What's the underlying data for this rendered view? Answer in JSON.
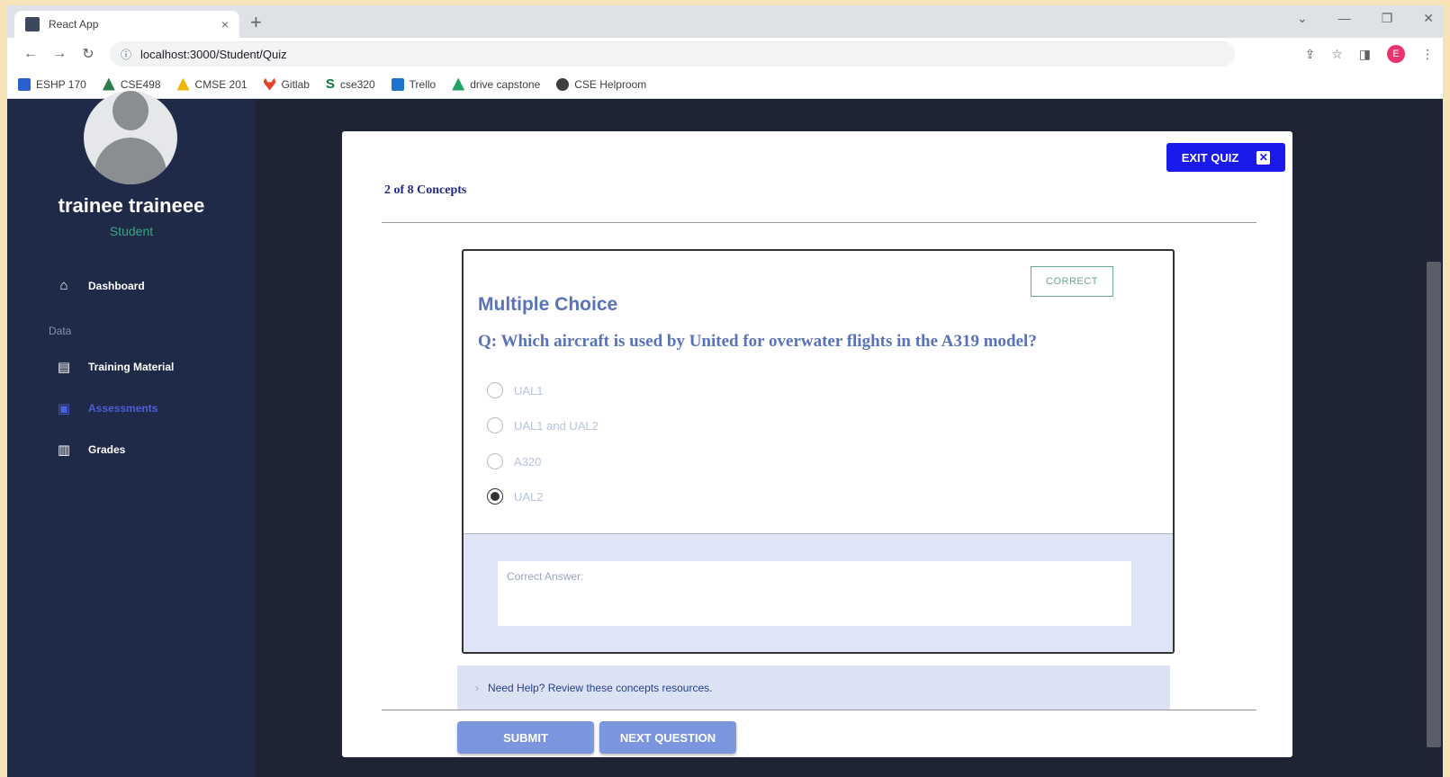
{
  "browser": {
    "tab_title": "React App",
    "tab_close": "×",
    "new_tab": "+",
    "url": "localhost:3000/Student/Quiz",
    "bookmarks": [
      "ESHP 170",
      "CSE498",
      "CMSE 201",
      "Gitlab",
      "cse320",
      "Trello",
      "drive capstone",
      "CSE Helproom"
    ],
    "profile_initial": "E"
  },
  "sidebar": {
    "user_name": "trainee traineee",
    "user_role": "Student",
    "section_label": "Data",
    "items": [
      {
        "label": "Dashboard",
        "icon": "home-icon"
      },
      {
        "label": "Training Material",
        "icon": "book-icon"
      },
      {
        "label": "Assessments",
        "icon": "clipboard-icon",
        "active": true
      },
      {
        "label": "Grades",
        "icon": "grades-icon"
      }
    ]
  },
  "quiz": {
    "exit_label": "EXIT QUIZ",
    "progress": "2 of 8 Concepts",
    "status_badge": "CORRECT",
    "question_type": "Multiple Choice",
    "question": "Q: Which aircraft is used by United for overwater flights in the A319 model?",
    "options": [
      {
        "label": "UAL1",
        "selected": false
      },
      {
        "label": "UAL1 and UAL2",
        "selected": false
      },
      {
        "label": "A320",
        "selected": false
      },
      {
        "label": "UAL2",
        "selected": true
      }
    ],
    "answer_placeholder": "Correct Answer:",
    "help_text": "Need Help? Review these concepts resources.",
    "submit_label": "SUBMIT",
    "next_label": "NEXT QUESTION"
  },
  "colors": {
    "sidebar_bg": "#1f2a48",
    "accent_blue": "#1a1aeb",
    "question_text": "#5873b8",
    "button_blue": "#7b96de",
    "correct_green": "#6aa890"
  }
}
